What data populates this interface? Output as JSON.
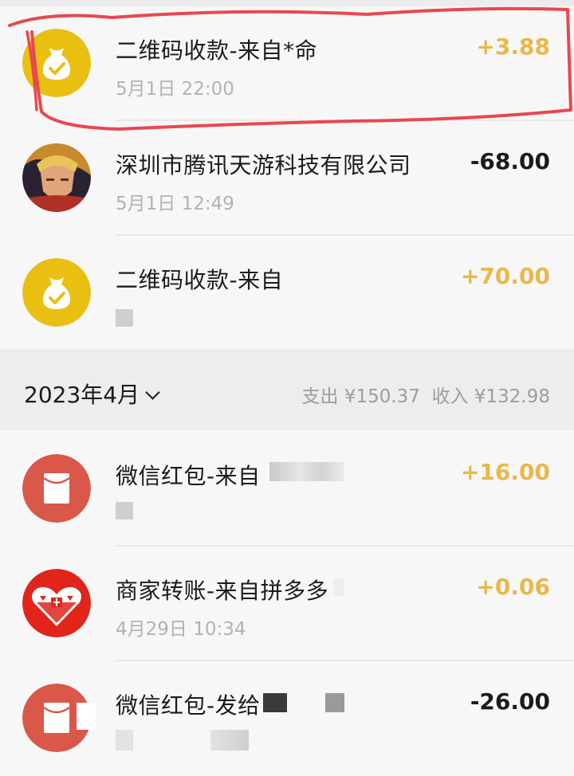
{
  "transactions_top": [
    {
      "title": "二维码收款-来自*命",
      "date": "5月1日 22:00",
      "amount": "+3.88",
      "type": "income",
      "icon": "money-bag-icon"
    },
    {
      "title": "深圳市腾讯天游科技有限公司",
      "date": "5月1日 12:49",
      "amount": "-68.00",
      "type": "expense",
      "icon": "game-avatar-icon"
    },
    {
      "title": "二维码收款-来自",
      "date": "",
      "amount": "+70.00",
      "type": "income",
      "icon": "money-bag-icon"
    }
  ],
  "month_header": {
    "label": "2023年4月",
    "expense": "支出 ¥150.37",
    "income": "收入 ¥132.98"
  },
  "transactions_april": [
    {
      "title": "微信红包-来自",
      "date": "",
      "amount": "+16.00",
      "type": "income",
      "icon": "red-packet-icon"
    },
    {
      "title": "商家转账-来自拼多多",
      "date": "4月29日 10:34",
      "amount": "+0.06",
      "type": "income",
      "icon": "pinduoduo-logo-icon"
    },
    {
      "title": "微信红包-发给",
      "date": "",
      "amount": "-26.00",
      "type": "expense",
      "icon": "red-packet-icon"
    }
  ],
  "colors": {
    "income": "#e8b84a",
    "expense": "#1b1b1b",
    "wallet_yellow": "#e9bf12",
    "red_packet": "#d9584a",
    "pinduoduo_red": "#e1251b",
    "annotation_red": "#e84850"
  }
}
